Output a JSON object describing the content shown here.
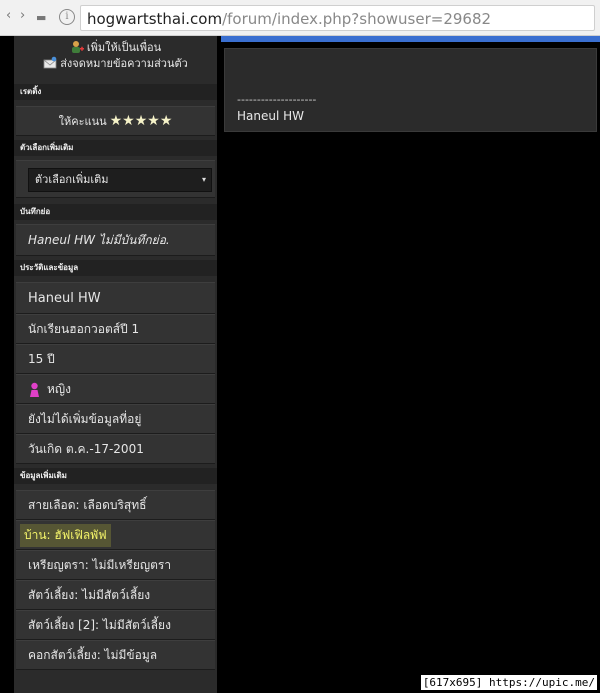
{
  "browser": {
    "back_glyph": "‹",
    "forward_glyph": "›",
    "menu_glyph": "▬",
    "url_host": "hogwartsthai.com",
    "url_path": "/forum/index.php?showuser=29682",
    "info_glyph": "i"
  },
  "contact": {
    "add_friend": "เพิ่มให้เป็นเพื่อน",
    "send_pm": "ส่งจดหมายข้อความส่วนตัว"
  },
  "sections": {
    "rating_title": "เรตติ้ง",
    "rating_label": "ให้คะแนน",
    "rating_stars": "★★★★★",
    "options_title": "ตัวเลือกเพิ่มเติม",
    "options_select": "ตัวเลือกเพิ่มเติม",
    "options_arrow": "▾",
    "note_title": "บันทึกย่อ",
    "note_text": "Haneul HW  ไม่มีบันทึกย่อ.",
    "bio_title": "ประวัติและข้อมูล",
    "extra_title": "ข้อมูลเพิ่มเติม"
  },
  "bio": {
    "name": "Haneul HW",
    "group": "นักเรียนฮอกวอตส์ปี 1",
    "age": "15 ปี",
    "gender": "หญิง",
    "location": "ยังไม่ได้เพิ่มข้อมูลที่อยู่",
    "birthday": "วันเกิด ต.ค.-17-2001"
  },
  "extra": {
    "blood": "สายเลือด: เลือดบริสุทธิ์",
    "house": "บ้าน: ฮัฟเฟิลพัฟ",
    "medal": "เหรียญตรา: ไม่มีเหรียญตรา",
    "pet1": "สัตว์เลี้ยง: ไม่มีสัตว์เลี้ยง",
    "pet2": "สัตว์เลี้ยง [2]: ไม่มีสัตว์เลี้ยง",
    "pet_house": "คอกสัตว์เลี้ยง: ไม่มีข้อมูล"
  },
  "post": {
    "divider": "--------------------",
    "signature": "Haneul HW"
  },
  "watermark": "[617x695] https://upic.me/",
  "colors": {
    "accent": "#3a6fd0",
    "highlight": "#fafa3c"
  }
}
